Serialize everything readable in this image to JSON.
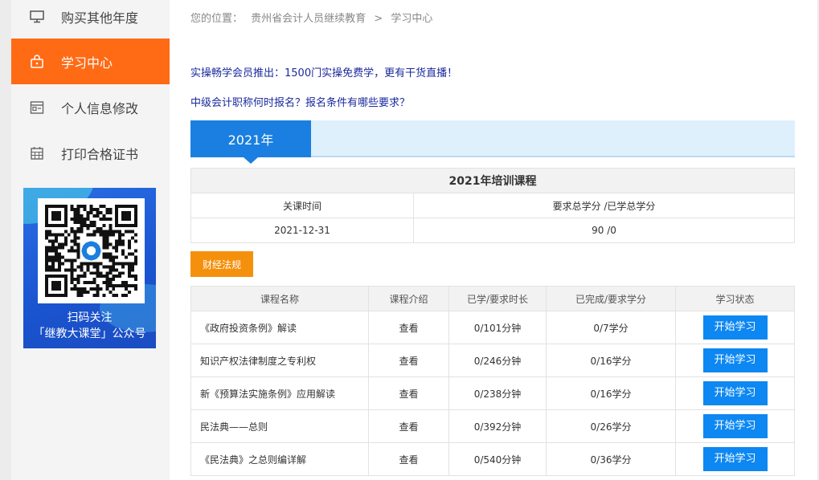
{
  "sidebar": {
    "items": [
      {
        "label": "购买其他年度",
        "icon": "monitor-icon",
        "active": false
      },
      {
        "label": "学习中心",
        "icon": "lock-bag-icon",
        "active": true
      },
      {
        "label": "个人信息修改",
        "icon": "profile-card-icon",
        "active": false
      },
      {
        "label": "打印合格证书",
        "icon": "calendar-grid-icon",
        "active": false
      }
    ],
    "qr": {
      "line1": "扫码关注",
      "line2": "「继教大课堂」公众号"
    }
  },
  "breadcrumb": {
    "prefix": "您的位置：",
    "item1": "贵州省会计人员继续教育",
    "sep": ">",
    "item2": "学习中心"
  },
  "notices": [
    "实操畅学会员推出：1500门实操免费学，更有干货直播！",
    "中级会计职称何时报名？报名条件有哪些要求？"
  ],
  "year_tab": "2021年",
  "summary": {
    "title": "2021年培训课程",
    "col1": "关课时间",
    "col2": "要求总学分 /已学总学分",
    "val1": "2021-12-31",
    "val2": "90 /0"
  },
  "category": "财经法规",
  "courses": {
    "headers": [
      "课程名称",
      "课程介绍",
      "已学/要求时长",
      "已完成/要求学分",
      "学习状态"
    ],
    "rows": [
      {
        "name": "《政府投资条例》解读",
        "intro": "查看",
        "time": "0/101分钟",
        "credit": "0/7学分",
        "action": "开始学习"
      },
      {
        "name": "知识产权法律制度之专利权",
        "intro": "查看",
        "time": "0/246分钟",
        "credit": "0/16学分",
        "action": "开始学习"
      },
      {
        "name": "新《预算法实施条例》应用解读",
        "intro": "查看",
        "time": "0/238分钟",
        "credit": "0/16学分",
        "action": "开始学习"
      },
      {
        "name": "民法典——总则",
        "intro": "查看",
        "time": "0/392分钟",
        "credit": "0/26学分",
        "action": "开始学习"
      },
      {
        "name": "《民法典》之总则编详解",
        "intro": "查看",
        "time": "0/540分钟",
        "credit": "0/36学分",
        "action": "开始学习"
      }
    ]
  },
  "colors": {
    "accent_orange": "#ff6a14",
    "primary_blue": "#0d87f2",
    "category_orange": "#f5900d",
    "notice_blue": "#1a2a9c"
  }
}
